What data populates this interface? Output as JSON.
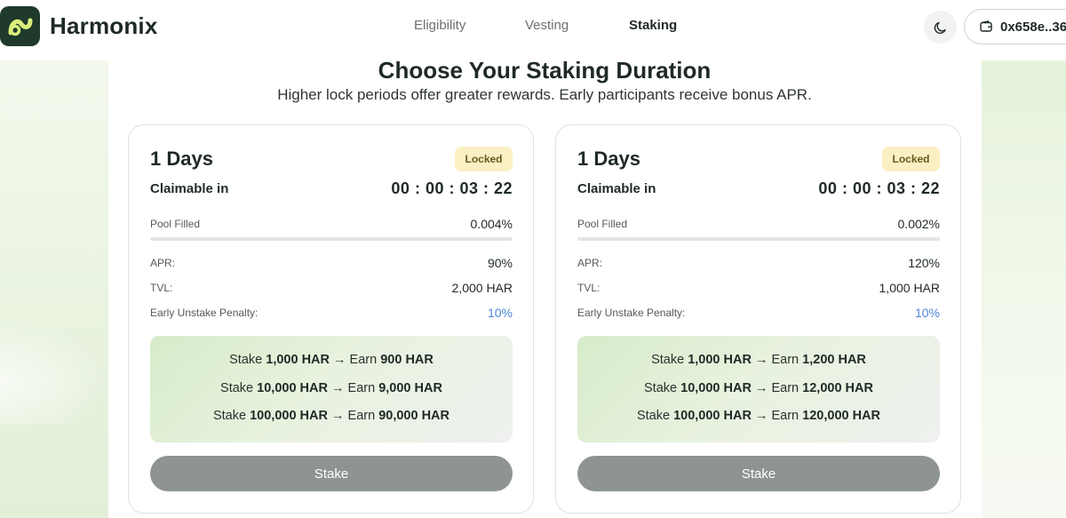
{
  "brand": {
    "name": "Harmonix"
  },
  "nav": {
    "items": [
      {
        "label": "Eligibility",
        "active": false
      },
      {
        "label": "Vesting",
        "active": false
      },
      {
        "label": "Staking",
        "active": true
      }
    ]
  },
  "header": {
    "wallet_label": "0x658e..36",
    "theme_icon": "moon-icon",
    "wallet_icon": "wallet-icon"
  },
  "page": {
    "title": "Choose Your Staking Duration",
    "subtitle": "Higher lock periods offer greater rewards. Early participants receive bonus APR."
  },
  "cards": [
    {
      "title": "1 Days",
      "badge": "Locked",
      "claim_label": "Claimable in",
      "countdown": "00 : 00 : 03 : 22",
      "pool_label": "Pool Filled",
      "pool_value": "0.004%",
      "pool_fraction": 4e-05,
      "apr_label": "APR:",
      "apr_value": "90%",
      "tvl_label": "TVL:",
      "tvl_value": "2,000 HAR",
      "penalty_label": "Early Unstake Penalty:",
      "penalty_value": "10%",
      "examples": [
        {
          "stake": "1,000 HAR",
          "earn": "900 HAR"
        },
        {
          "stake": "10,000 HAR",
          "earn": "9,000 HAR"
        },
        {
          "stake": "100,000 HAR",
          "earn": "90,000 HAR"
        }
      ],
      "stake_prefix": "Stake",
      "arrow_text": "→ Earn",
      "button_label": "Stake"
    },
    {
      "title": "1 Days",
      "badge": "Locked",
      "claim_label": "Claimable in",
      "countdown": "00 : 00 : 03 : 22",
      "pool_label": "Pool Filled",
      "pool_value": "0.002%",
      "pool_fraction": 2e-05,
      "apr_label": "APR:",
      "apr_value": "120%",
      "tvl_label": "TVL:",
      "tvl_value": "1,000 HAR",
      "penalty_label": "Early Unstake Penalty:",
      "penalty_value": "10%",
      "examples": [
        {
          "stake": "1,000 HAR",
          "earn": "1,200 HAR"
        },
        {
          "stake": "10,000 HAR",
          "earn": "12,000 HAR"
        },
        {
          "stake": "100,000 HAR",
          "earn": "120,000 HAR"
        }
      ],
      "stake_prefix": "Stake",
      "arrow_text": "→ Earn",
      "button_label": "Stake"
    }
  ]
}
